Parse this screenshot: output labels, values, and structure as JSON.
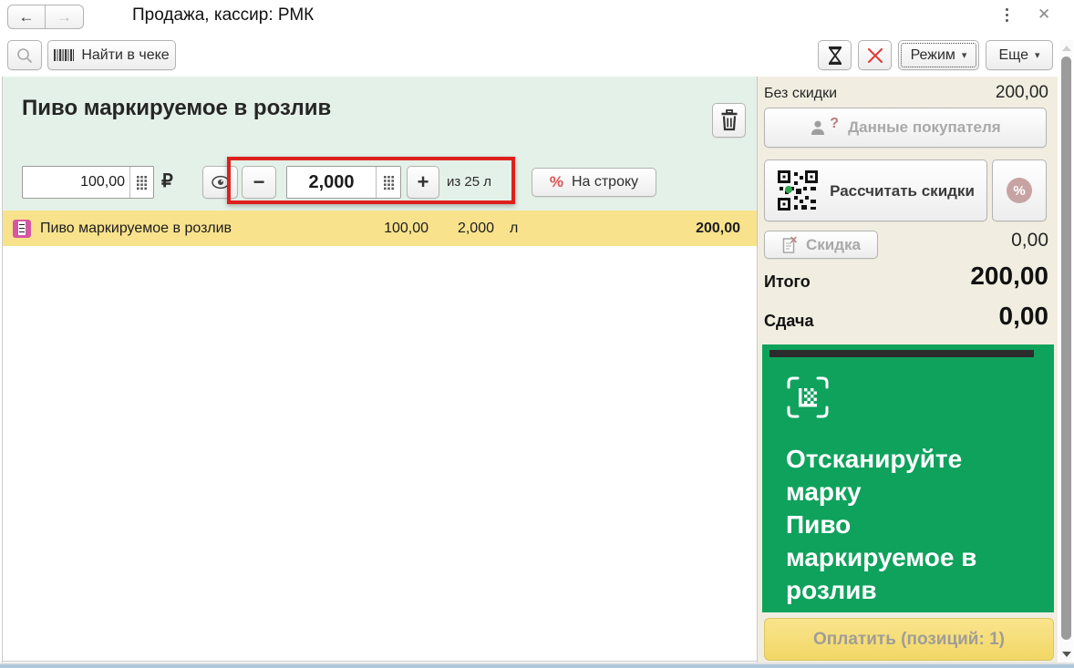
{
  "colors": {
    "accent_green": "#0fa25c",
    "panel_beige": "#f1eee1",
    "section_mint": "#e4f1e8",
    "row_yellow": "#f8e28c",
    "annotation_red": "#de201d",
    "alert_red": "#e23b3b",
    "marking_pink": "#d357a3",
    "pay_yellow": "#f2d765"
  },
  "header": {
    "title": "Продажа, кассир: РМК"
  },
  "toolbar": {
    "find_button_label": "Найти в чеке",
    "mode_button_label": "Режим",
    "more_button_label": "Еще"
  },
  "item_editor": {
    "heading": "Пиво маркируемое в розлив",
    "price_value": "100,00",
    "currency_symbol": "₽",
    "minus_label": "−",
    "qty_value": "2,000",
    "plus_label": "+",
    "capacity_hint": "из 25 л",
    "percent_symbol": "%",
    "line_discount_label": "На строку"
  },
  "receipt": {
    "rows": [
      {
        "name": "Пиво маркируемое в розлив",
        "price": "100,00",
        "qty": "2,000",
        "unit": "л",
        "total": "200,00"
      }
    ]
  },
  "summary": {
    "no_discount_label": "Без скидки",
    "no_discount_value": "200,00",
    "customer_button_label": "Данные покупателя",
    "customer_unknown_mark": "?",
    "calc_discounts_label": "Рассчитать скидки",
    "percent_symbol": "%",
    "discount_button_label": "Скидка",
    "discount_value": "0,00",
    "total_label": "Итого",
    "total_value": "200,00",
    "change_label": "Сдача",
    "change_value": "0,00"
  },
  "scan_panel": {
    "prompt": "Отсканируйте марку",
    "item_name": "Пиво маркируемое в розлив"
  },
  "pay_button_label": "Оплатить (позиций: 1)"
}
